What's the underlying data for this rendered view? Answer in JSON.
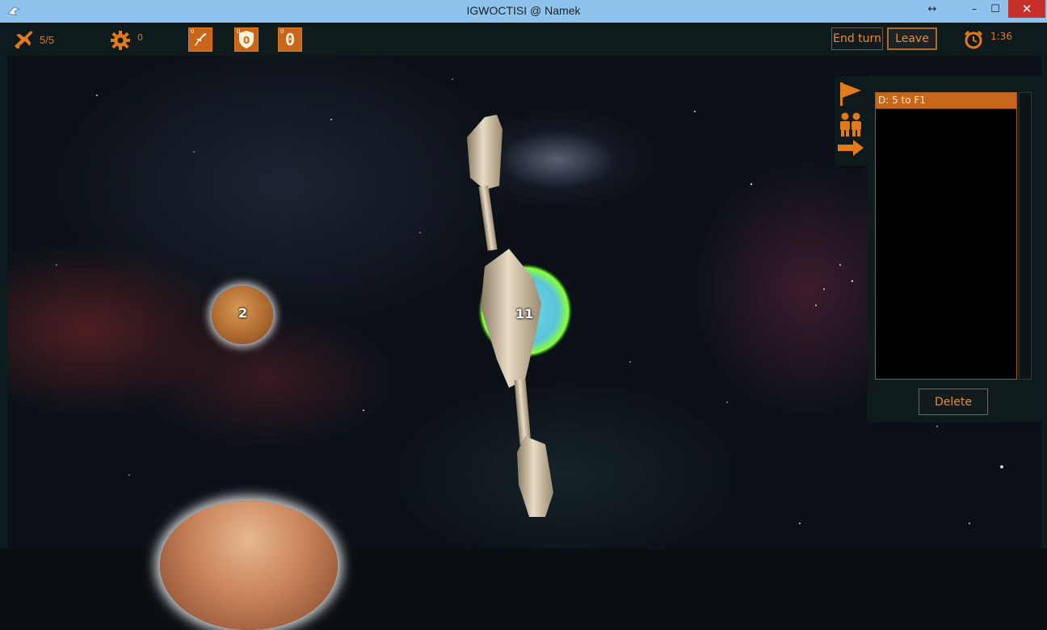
{
  "window": {
    "title": "IGWOCTISI @ Namek",
    "resize_glyph": "↔",
    "min_glyph": "–",
    "max_glyph": "☐",
    "close_glyph": "✕"
  },
  "hud": {
    "fleet_count": "5/5",
    "gear_count": "0",
    "tech_badges": [
      "0",
      "0",
      "0"
    ],
    "shield_value": "0",
    "zero_value": "0",
    "end_turn_label": "End turn",
    "leave_label": "Leave",
    "timer": "1:36",
    "accent": "#e07a1a"
  },
  "panel": {
    "orders": [
      "D: 5 to F1"
    ],
    "delete_label": "Delete",
    "icons": [
      "flag-icon",
      "players-icon",
      "arrow-right-icon"
    ]
  },
  "map": {
    "planets": [
      {
        "label": "2"
      },
      {
        "label": "11"
      }
    ]
  }
}
